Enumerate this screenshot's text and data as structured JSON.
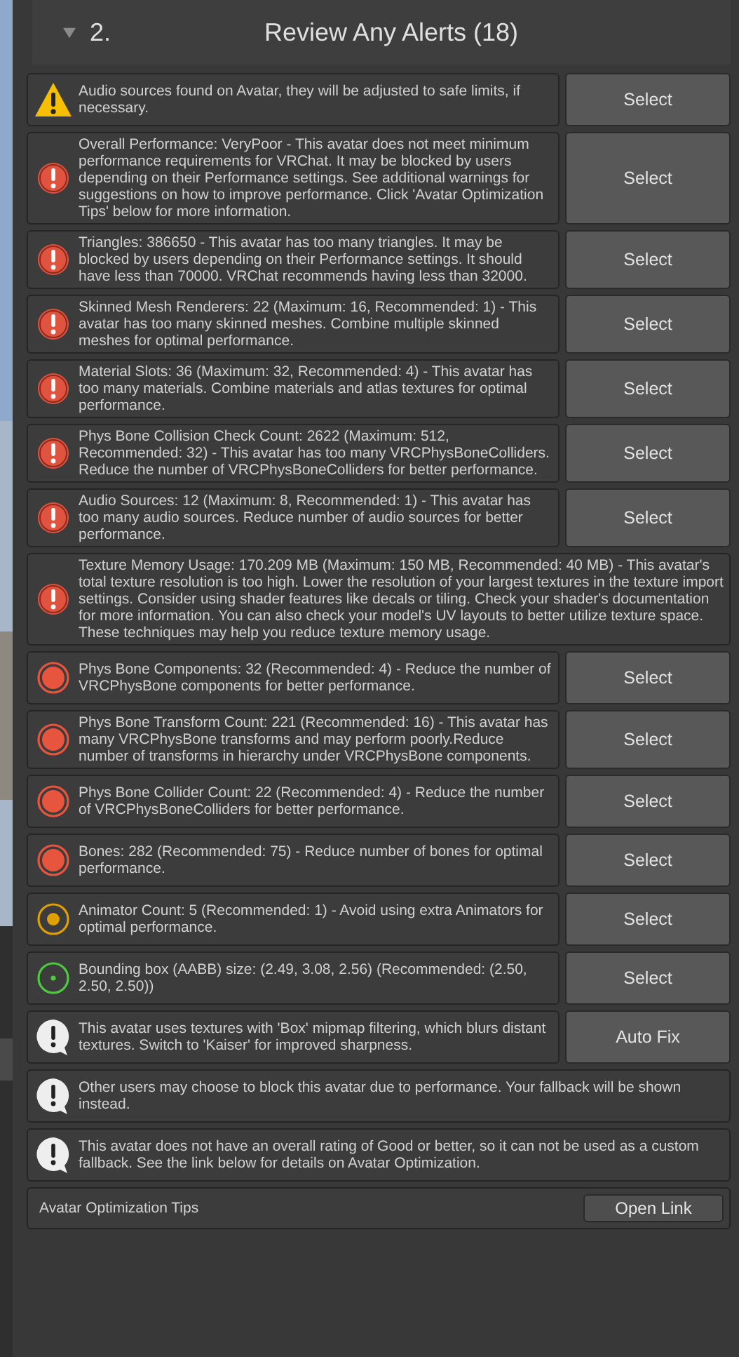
{
  "section": {
    "number": "2.",
    "title": "Review Any Alerts (18)",
    "expanded": true
  },
  "alerts": [
    {
      "kind": "warning",
      "message": "Audio sources found on Avatar, they will be adjusted to safe limits, if necessary.",
      "action": "Select"
    },
    {
      "kind": "error",
      "message": "Overall Performance: VeryPoor - This avatar does not meet minimum performance requirements for VRChat. It may be blocked by users depending on their Performance settings. See additional warnings for suggestions on how to improve performance. Click 'Avatar Optimization Tips' below for more information.",
      "action": "Select"
    },
    {
      "kind": "error",
      "message": "Triangles: 386650 - This avatar has too many triangles. It may be blocked by users depending on their Performance settings. It should have less than 70000. VRChat recommends having less than 32000.",
      "action": "Select"
    },
    {
      "kind": "error",
      "message": "Skinned Mesh Renderers: 22 (Maximum: 16, Recommended: 1) - This avatar has too many skinned meshes. Combine multiple skinned meshes for optimal performance.",
      "action": "Select"
    },
    {
      "kind": "error",
      "message": "Material Slots: 36 (Maximum: 32, Recommended: 4) - This avatar has too many materials. Combine materials and atlas textures for optimal performance.",
      "action": "Select"
    },
    {
      "kind": "error",
      "message": "Phys Bone Collision Check Count: 2622 (Maximum: 512, Recommended: 32) - This avatar has too many VRCPhysBoneColliders. Reduce the number of VRCPhysBoneColliders for better performance.",
      "action": "Select"
    },
    {
      "kind": "error",
      "message": "Audio Sources: 12 (Maximum: 8, Recommended: 1) - This avatar has too many audio sources. Reduce number of audio sources for better performance.",
      "action": "Select"
    },
    {
      "kind": "error",
      "message": "Texture Memory Usage: 170.209 MB (Maximum: 150 MB, Recommended: 40 MB) - This avatar's total texture resolution is too high. Lower the resolution of your largest textures in the texture import settings. Consider using shader features like decals or tiling. Check your shader's documentation for more information. You can also check your model's UV layouts to better utilize texture space. These techniques may help you reduce texture memory usage."
    },
    {
      "kind": "very_poor",
      "message": "Phys Bone Components: 32 (Recommended: 4) - Reduce the number of VRCPhysBone components for better performance.",
      "action": "Select"
    },
    {
      "kind": "very_poor",
      "message": "Phys Bone Transform Count: 221 (Recommended: 16) - This avatar has many VRCPhysBone transforms and may perform poorly.Reduce number of transforms in hierarchy under VRCPhysBone components.",
      "action": "Select"
    },
    {
      "kind": "very_poor",
      "message": "Phys Bone Collider Count: 22 (Recommended: 4) - Reduce the number of VRCPhysBoneColliders for better performance.",
      "action": "Select"
    },
    {
      "kind": "very_poor",
      "message": "Bones: 282 (Recommended: 75) - Reduce number of bones for optimal performance.",
      "action": "Select"
    },
    {
      "kind": "medium",
      "message": "Animator Count: 5 (Recommended: 1) - Avoid using extra Animators for optimal performance.",
      "action": "Select"
    },
    {
      "kind": "good",
      "message": "Bounding box (AABB) size: (2.49, 3.08, 2.56) (Recommended: (2.50, 2.50, 2.50))",
      "action": "Select"
    },
    {
      "kind": "info",
      "message": "This avatar uses textures with 'Box' mipmap filtering, which blurs distant textures. Switch to 'Kaiser' for improved sharpness.",
      "action": "Auto Fix"
    },
    {
      "kind": "info",
      "message": "Other users may choose to block this avatar due to performance. Your fallback will be shown instead."
    },
    {
      "kind": "info",
      "message": "This avatar does not have an overall rating of Good or better, so it can not be used as a custom fallback. See the link below for details on Avatar Optimization."
    }
  ],
  "footer": {
    "label": "Avatar Optimization Tips",
    "button": "Open Link"
  }
}
